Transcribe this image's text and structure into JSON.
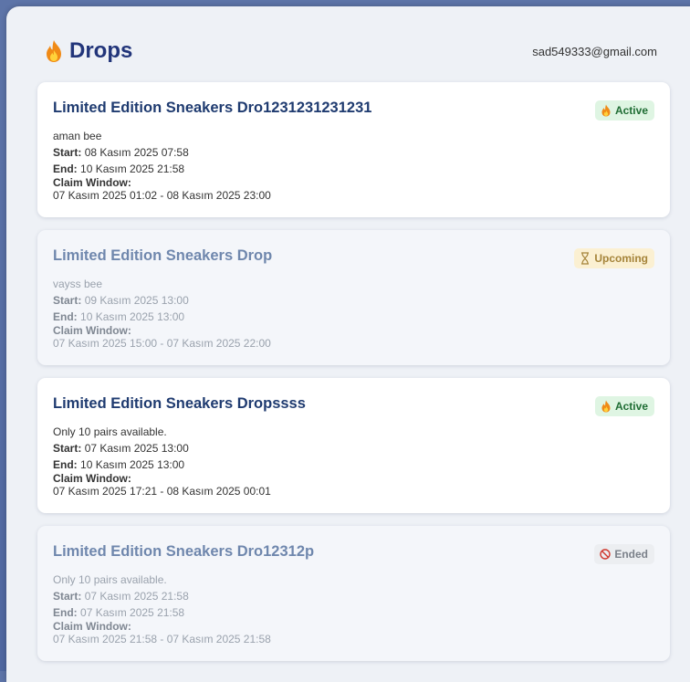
{
  "header": {
    "title": "Drops",
    "email": "sad549333@gmail.com"
  },
  "labels": {
    "start": "Start:",
    "end": "End:",
    "claim_window": "Claim Window:"
  },
  "drops": [
    {
      "title": "Limited Edition Sneakers Dro1231231231231",
      "description": "aman bee",
      "start": "08 Kasım 2025 07:58",
      "end": "10 Kasım 2025 21:58",
      "claim_window": "07 Kasım 2025 01:02 - 08 Kasım 2025 23:00",
      "status": "Active",
      "status_icon": "flame-icon"
    },
    {
      "title": "Limited Edition Sneakers Drop",
      "description": "vayss bee",
      "start": "09 Kasım 2025 13:00",
      "end": "10 Kasım 2025 13:00",
      "claim_window": "07 Kasım 2025 15:00 - 07 Kasım 2025 22:00",
      "status": "Upcoming",
      "status_icon": "hourglass-icon"
    },
    {
      "title": "Limited Edition Sneakers Dropssss",
      "description": "Only 10 pairs available.",
      "start": "07 Kasım 2025 13:00",
      "end": "10 Kasım 2025 13:00",
      "claim_window": "07 Kasım 2025 17:21 - 08 Kasım 2025 00:01",
      "status": "Active",
      "status_icon": "flame-icon"
    },
    {
      "title": "Limited Edition Sneakers Dro12312p",
      "description": "Only 10 pairs available.",
      "start": "07 Kasım 2025 21:58",
      "end": "07 Kasım 2025 21:58",
      "claim_window": "07 Kasım 2025 21:58 - 07 Kasım 2025 21:58",
      "status": "Ended",
      "status_icon": "prohibited-icon"
    }
  ],
  "colors": {
    "title": "#22357a",
    "active_bg": "#dff5e3",
    "upcoming_bg": "#fbf0d2",
    "ended_bg": "#eceef1"
  }
}
